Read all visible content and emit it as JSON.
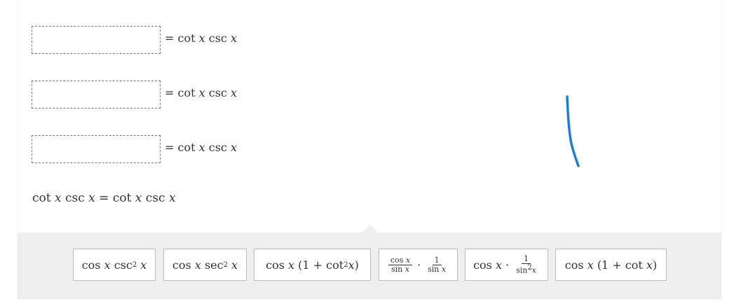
{
  "steps": [
    {
      "rhs": "= cot x csc x"
    },
    {
      "rhs": "= cot x csc x"
    },
    {
      "rhs": "= cot x csc x"
    }
  ],
  "final_equation": "cot x csc x = cot x csc x",
  "stroke_color": "#1a7fd4",
  "tiles": [
    {
      "label": "cos x csc² x"
    },
    {
      "label": "cos x sec² x"
    },
    {
      "label": "cos x (1 + cot²x)"
    },
    {
      "label": "cos x / sin x · 1 / sin x"
    },
    {
      "label": "cos x · 1 / sin²x"
    },
    {
      "label": "cos x (1 + cot x)"
    }
  ]
}
